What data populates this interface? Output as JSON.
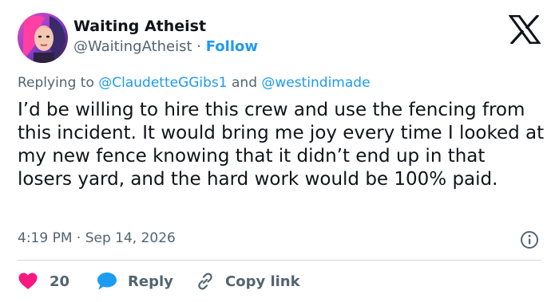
{
  "author": {
    "display_name": "Waiting Atheist",
    "handle": "@WaitingAtheist",
    "separator": " · ",
    "follow_label": "Follow"
  },
  "reply_context": {
    "prefix": "Replying to ",
    "mention_1": "@ClaudetteGGibs1",
    "conjunction": " and ",
    "mention_2": "@westindimade"
  },
  "tweet": {
    "text": "I’d be willing to hire this crew and use the fencing from this incident. It would bring me joy every time I looked at my new fence knowing that it didn’t end up in that losers yard, and the hard work would be 100% paid.",
    "time": "4:19 PM",
    "date_separator": " · ",
    "date": "Sep 14, 2026"
  },
  "actions": {
    "like_count": "20",
    "reply_label": "Reply",
    "copy_link_label": "Copy link"
  },
  "colors": {
    "accent": "#1d9bf0",
    "like": "#f91880",
    "text": "#0f1419",
    "muted": "#536471"
  },
  "icons": {
    "brand": "x-logo-icon",
    "info": "info-icon",
    "like": "heart-icon",
    "reply": "speech-bubble-icon",
    "copy": "link-icon"
  }
}
